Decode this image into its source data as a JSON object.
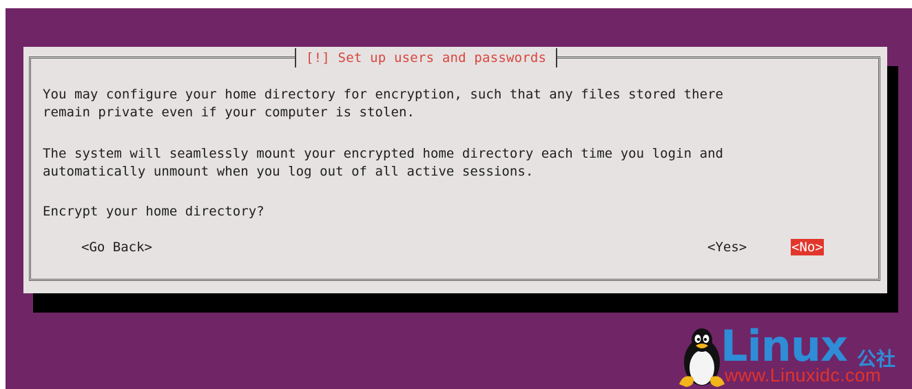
{
  "dialog": {
    "title": "[!] Set up users and passwords",
    "paragraph1_line1": "You may configure your home directory for encryption, such that any files stored there",
    "paragraph1_line2": "remain private even if your computer is stolen.",
    "paragraph2_line1": "The system will seamlessly mount your encrypted home directory each time you login and",
    "paragraph2_line2": "automatically unmount when you log out of all active sessions.",
    "question": "Encrypt your home directory?",
    "buttons": {
      "back": "<Go Back>",
      "yes": "<Yes>",
      "no": "<No>"
    },
    "selected_button": "no"
  },
  "watermark": {
    "brand": "Linux",
    "brand_cn": "公社",
    "url": "www.Linuxidc.com",
    "icon": "tux-penguin-icon"
  },
  "colors": {
    "background": "#702567",
    "dialog": "#e6e2e2",
    "title": "#d9453c",
    "selected_button": "#e2362b",
    "watermark_blue": "#2f8cd6",
    "watermark_red": "#e0342b"
  }
}
